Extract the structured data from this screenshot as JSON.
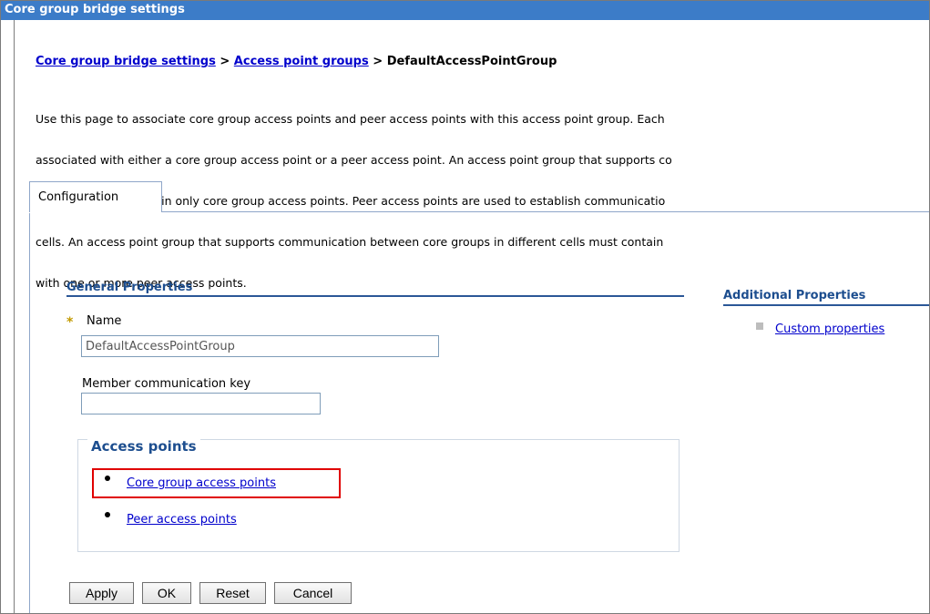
{
  "window": {
    "title": "Core group bridge settings"
  },
  "breadcrumb": {
    "items": [
      "Core group bridge settings",
      "Access point groups"
    ],
    "separator": ">",
    "current": "DefaultAccessPointGroup"
  },
  "description": {
    "lines": [
      "Use this page to associate core group access points and peer access points with this access point group. Each",
      "associated with either a core group access point or a peer access point. An access point group that supports co",
      "in this cell must contain only core group access points. Peer access points are used to establish communicatio",
      "cells. An access point group that supports communication between core groups in different cells must contain",
      "with one or more peer access points."
    ]
  },
  "tabs": [
    {
      "label": "Configuration",
      "active": true
    }
  ],
  "general_properties": {
    "heading": "General Properties",
    "required_marker": "*",
    "name_label": "Name",
    "name_value": "DefaultAccessPointGroup",
    "key_label": "Member communication key",
    "key_value": ""
  },
  "access_points": {
    "legend": "Access points",
    "links": [
      "Core group access points",
      "Peer access points"
    ],
    "highlighted": "Core group access points"
  },
  "additional_properties": {
    "heading": "Additional Properties",
    "links": [
      "Custom properties"
    ]
  },
  "buttons": {
    "apply": "Apply",
    "ok": "OK",
    "reset": "Reset",
    "cancel": "Cancel"
  },
  "colors": {
    "title_bar": "#3c7cc8",
    "link": "#0000cc",
    "heading": "#1d4e8f",
    "highlight": "#e00000"
  }
}
